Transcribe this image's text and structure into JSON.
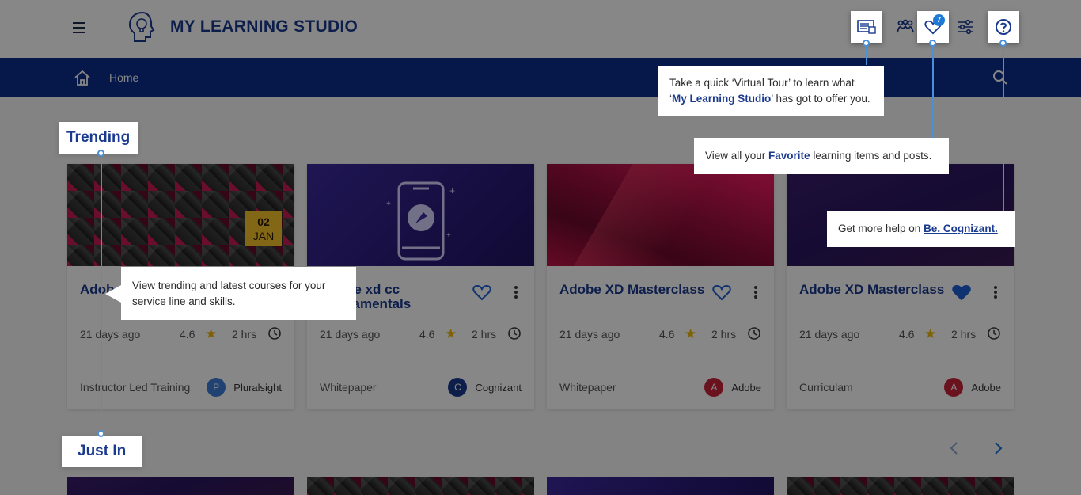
{
  "header": {
    "app_title": "MY LEARNING STUDIO",
    "favorites_count": "7",
    "icons": [
      "menu-icon",
      "brain-logo-icon",
      "virtual-tour-icon",
      "community-icon",
      "heart-icon",
      "filter-sliders-icon",
      "help-icon"
    ]
  },
  "nav": {
    "home_label": "Home"
  },
  "sections": {
    "trending": "Trending",
    "just_in": "Just In"
  },
  "cards": [
    {
      "title": "Adobe XD Masterclass",
      "date_day": "02",
      "date_month": "JAN",
      "posted": "21 days ago",
      "rating": "4.6",
      "duration": "2 hrs",
      "type": "Instructor Led Training",
      "provider_initial": "P",
      "provider": "Pluralsight",
      "provider_color": "#3b7dd8",
      "favorited": false
    },
    {
      "title": "Adobe xd cc Fundamentals",
      "posted": "21 days ago",
      "rating": "4.6",
      "duration": "2 hrs",
      "type": "Whitepaper",
      "provider_initial": "C",
      "provider": "Cognizant",
      "provider_color": "#1a3a8f",
      "favorited": false
    },
    {
      "title": "Adobe XD Masterclass",
      "posted": "21 days ago",
      "rating": "4.6",
      "duration": "2 hrs",
      "type": "Whitepaper",
      "provider_initial": "A",
      "provider": "Adobe",
      "provider_color": "#c8243c",
      "favorited": false
    },
    {
      "title": "Adobe XD Masterclass",
      "posted": "21 days ago",
      "rating": "4.6",
      "duration": "2 hrs",
      "type": "Curriculam",
      "provider_initial": "A",
      "provider": "Adobe",
      "provider_color": "#c8243c",
      "favorited": true
    }
  ],
  "tooltips": {
    "virtual_tour_pre": "Take a quick ‘Virtual Tour’ to learn what ‘",
    "virtual_tour_bold": "My Learning Studio",
    "virtual_tour_post": "’ has got to offer you.",
    "favorites_pre": "View all your ",
    "favorites_bold": "Favorite",
    "favorites_post": " learning items and posts.",
    "help_pre": "Get more help on ",
    "help_link": "Be. Cognizant.",
    "trending": "View trending and latest courses for your service line and skills."
  },
  "colors": {
    "brand": "#1a3a8f",
    "nav_bg": "#0b2f8a",
    "connector": "#4a90d9",
    "star": "#f2b705"
  }
}
